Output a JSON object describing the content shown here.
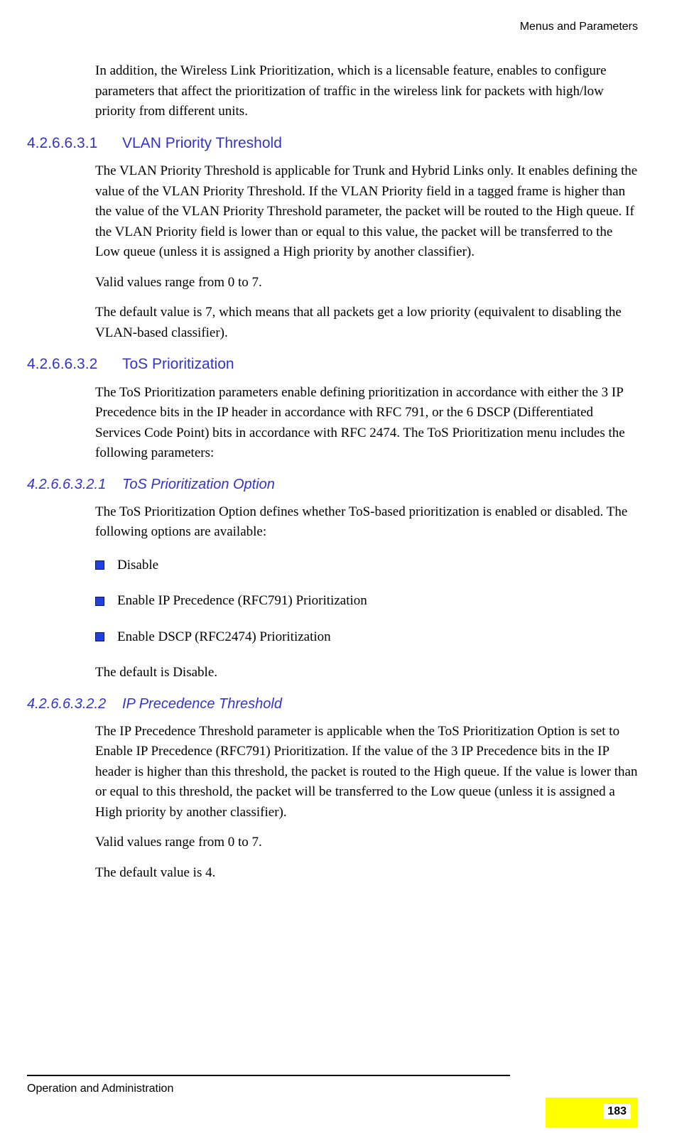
{
  "header": {
    "running": "Menus and Parameters"
  },
  "intro_para": "In addition, the Wireless Link Prioritization, which is a licensable feature, enables to configure parameters that affect the prioritization of traffic in the wireless link for packets with high/low priority from different units.",
  "s1": {
    "num": "4.2.6.6.3.1",
    "title": "VLAN Priority Threshold",
    "p1": "The VLAN Priority Threshold is applicable for Trunk and Hybrid Links only. It enables defining the value of the VLAN Priority Threshold. If the VLAN Priority field in a tagged frame is higher than the value of the VLAN Priority Threshold parameter, the packet will be routed to the High queue. If the VLAN Priority field is lower than or equal to this value, the packet will be transferred to the Low queue (unless it is assigned a High priority by another classifier).",
    "p2": "Valid values range from 0 to 7.",
    "p3": "The default value is 7, which means that all packets get a low priority (equivalent to disabling the VLAN-based classifier)."
  },
  "s2": {
    "num": "4.2.6.6.3.2",
    "title": "ToS Prioritization",
    "p1": "The ToS Prioritization parameters enable defining prioritization in accordance with either the 3 IP Precedence bits in the IP header in accordance with RFC 791, or the 6 DSCP (Differentiated Services Code Point) bits in accordance with RFC 2474. The ToS Prioritization menu includes the following parameters:"
  },
  "s21": {
    "num": "4.2.6.6.3.2.1",
    "title": "ToS Prioritization Option",
    "p1": "The ToS Prioritization Option defines whether ToS-based prioritization is enabled or disabled. The following options are available:",
    "bullets": {
      "b1": "Disable",
      "b2": "Enable IP Precedence (RFC791) Prioritization",
      "b3": "Enable DSCP (RFC2474) Prioritization"
    },
    "p2": "The default is Disable."
  },
  "s22": {
    "num": "4.2.6.6.3.2.2",
    "title": "IP Precedence Threshold",
    "p1": "The IP Precedence Threshold parameter is applicable when the ToS Prioritization Option is set to Enable IP Precedence (RFC791) Prioritization. If the value of the 3 IP Precedence bits in the IP header is higher than this threshold, the packet is routed to the High queue. If the value is lower than or equal to this threshold, the packet will be transferred to the Low queue (unless it is assigned a High priority by another classifier).",
    "p2": "Valid values range from 0 to 7.",
    "p3": "The default value is 4."
  },
  "footer": {
    "text": "Operation and Administration",
    "page": "183"
  }
}
